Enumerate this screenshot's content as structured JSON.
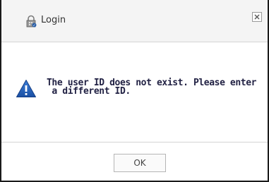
{
  "dialog": {
    "title": "Login",
    "message_line1": "The user ID does not exist. Please enter",
    "message_line2": " a different ID.",
    "ok_label": "OK"
  },
  "icons": {
    "title_icon": "lock-icon",
    "close_icon": "close-icon",
    "message_icon": "warning-icon"
  },
  "colors": {
    "warning_blue": "#1f5fbf",
    "titlebar_bg": "#f4f4f4",
    "frame": "#1a1a1a"
  }
}
